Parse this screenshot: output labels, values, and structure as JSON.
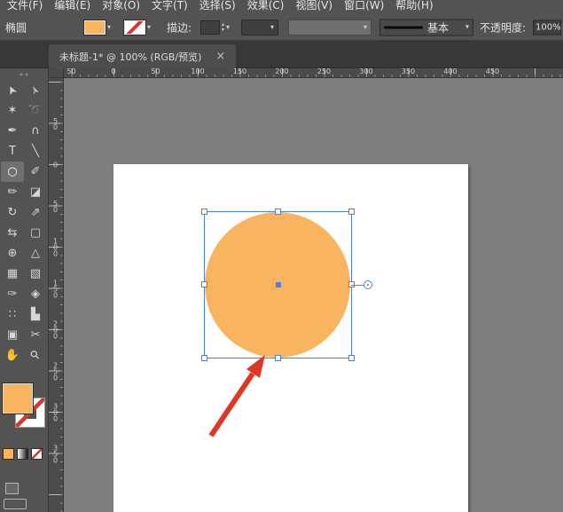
{
  "colors": {
    "fill_orange": "#f8b45f",
    "selection_blue": "#4a80e8",
    "annotation_red": "#dd3826"
  },
  "menubar": {
    "items": [
      "文件(F)",
      "编辑(E)",
      "对象(O)",
      "文字(T)",
      "选择(S)",
      "效果(C)",
      "视图(V)",
      "窗口(W)",
      "帮助(H)"
    ]
  },
  "control_bar": {
    "tool_label": "椭圆",
    "stroke_label": "描边:",
    "stroke_style_label": "基本",
    "opacity_label": "不透明度:",
    "opacity_value": "100%",
    "caret_down": "▾",
    "stepper_up": "▴",
    "stepper_down": "▾"
  },
  "tab": {
    "title": "未标题-1* @ 100% (RGB/预览)",
    "close_label": "×"
  },
  "rulers": {
    "horizontal": [
      "50",
      "0",
      "50",
      "100",
      "150",
      "200",
      "250",
      "300",
      "350",
      "400",
      "450"
    ],
    "vertical": [
      "50",
      "0",
      "50",
      "100",
      "150",
      "200",
      "250",
      "300",
      "350"
    ]
  },
  "tools": [
    {
      "name": "selection-tool",
      "glyph": "➤"
    },
    {
      "name": "direct-selection-tool",
      "glyph": "➢"
    },
    {
      "name": "magic-wand-tool",
      "glyph": "✶"
    },
    {
      "name": "lasso-tool",
      "glyph": "➰"
    },
    {
      "name": "pen-tool",
      "glyph": "✒"
    },
    {
      "name": "curvature-tool",
      "glyph": "∩"
    },
    {
      "name": "type-tool",
      "glyph": "T"
    },
    {
      "name": "line-segment-tool",
      "glyph": "╲"
    },
    {
      "name": "ellipse-tool",
      "glyph": "○",
      "selected": true
    },
    {
      "name": "paintbrush-tool",
      "glyph": "✐"
    },
    {
      "name": "pencil-tool",
      "glyph": "✏"
    },
    {
      "name": "eraser-tool",
      "glyph": "◪"
    },
    {
      "name": "rotate-tool",
      "glyph": "↻"
    },
    {
      "name": "scale-tool",
      "glyph": "⇗"
    },
    {
      "name": "width-tool",
      "glyph": "⇆"
    },
    {
      "name": "free-transform-tool",
      "glyph": "▢"
    },
    {
      "name": "shape-builder-tool",
      "glyph": "⊕"
    },
    {
      "name": "perspective-grid-tool",
      "glyph": "△"
    },
    {
      "name": "mesh-tool",
      "glyph": "▦"
    },
    {
      "name": "gradient-tool",
      "glyph": "▧"
    },
    {
      "name": "eyedropper-tool",
      "glyph": "✑"
    },
    {
      "name": "blend-tool",
      "glyph": "◈"
    },
    {
      "name": "symbol-sprayer-tool",
      "glyph": "∷"
    },
    {
      "name": "column-graph-tool",
      "glyph": "▙"
    },
    {
      "name": "artboard-tool",
      "glyph": "▣"
    },
    {
      "name": "slice-tool",
      "glyph": "✂"
    },
    {
      "name": "hand-tool",
      "glyph": "✋"
    },
    {
      "name": "zoom-tool",
      "glyph": "⚲"
    }
  ]
}
